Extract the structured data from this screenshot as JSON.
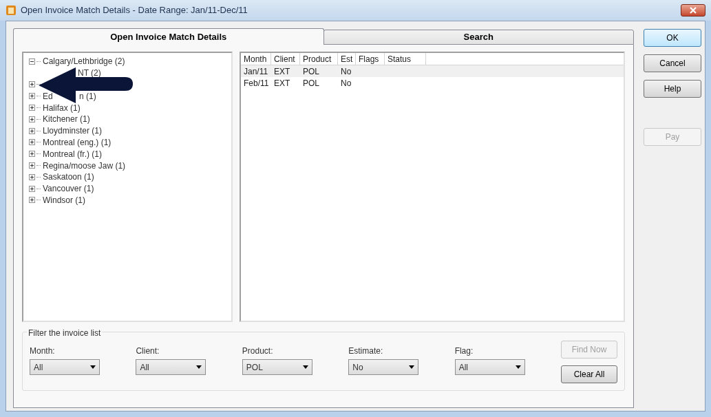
{
  "window": {
    "title": "Open Invoice Match Details - Date Range: Jan/11-Dec/11"
  },
  "tabs": [
    {
      "label": "Open Invoice Match Details",
      "selected": true
    },
    {
      "label": "Search",
      "selected": false
    }
  ],
  "tree": [
    {
      "label": "Calgary/Lethbridge (2)",
      "expanded": true,
      "children": [
        {
          "label": "NT (2)"
        }
      ]
    },
    {
      "expanded": false
    },
    {
      "label_parts": [
        "Ed",
        "n (1)"
      ],
      "expanded": false
    },
    {
      "label": "Halifax (1)",
      "expanded": false
    },
    {
      "label": "Kitchener (1)",
      "expanded": false
    },
    {
      "label": "Lloydminster (1)",
      "expanded": false
    },
    {
      "label": "Montreal (eng.) (1)",
      "expanded": false
    },
    {
      "label": "Montreal (fr.) (1)",
      "expanded": false
    },
    {
      "label": "Regina/moose Jaw (1)",
      "expanded": false
    },
    {
      "label": "Saskatoon (1)",
      "expanded": false
    },
    {
      "label": "Vancouver (1)",
      "expanded": false
    },
    {
      "label": "Windsor (1)",
      "expanded": false
    }
  ],
  "table": {
    "columns": [
      "Month",
      "Client",
      "Product",
      "Est",
      "Flags",
      "Status"
    ],
    "rows": [
      {
        "cells": [
          "Jan/11",
          "EXT",
          "POL",
          "No"
        ],
        "selected": true
      },
      {
        "cells": [
          "Feb/11",
          "EXT",
          "POL",
          "No"
        ],
        "selected": false
      }
    ]
  },
  "filter": {
    "title": "Filter the invoice list",
    "fields": [
      {
        "label": "Month:",
        "value": "All"
      },
      {
        "label": "Client:",
        "value": "All"
      },
      {
        "label": "Product:",
        "value": "POL"
      },
      {
        "label": "Estimate:",
        "value": "No"
      },
      {
        "label": "Flag:",
        "value": "All"
      }
    ],
    "buttons": [
      {
        "label": "Find Now",
        "disabled": true
      },
      {
        "label": "Clear All",
        "disabled": false
      }
    ]
  },
  "side_buttons": [
    {
      "label": "OK",
      "default": true,
      "disabled": false
    },
    {
      "label": "Cancel",
      "default": false,
      "disabled": false
    },
    {
      "label": "Help",
      "default": false,
      "disabled": false
    },
    {
      "label": "Pay",
      "default": false,
      "disabled": true
    }
  ]
}
